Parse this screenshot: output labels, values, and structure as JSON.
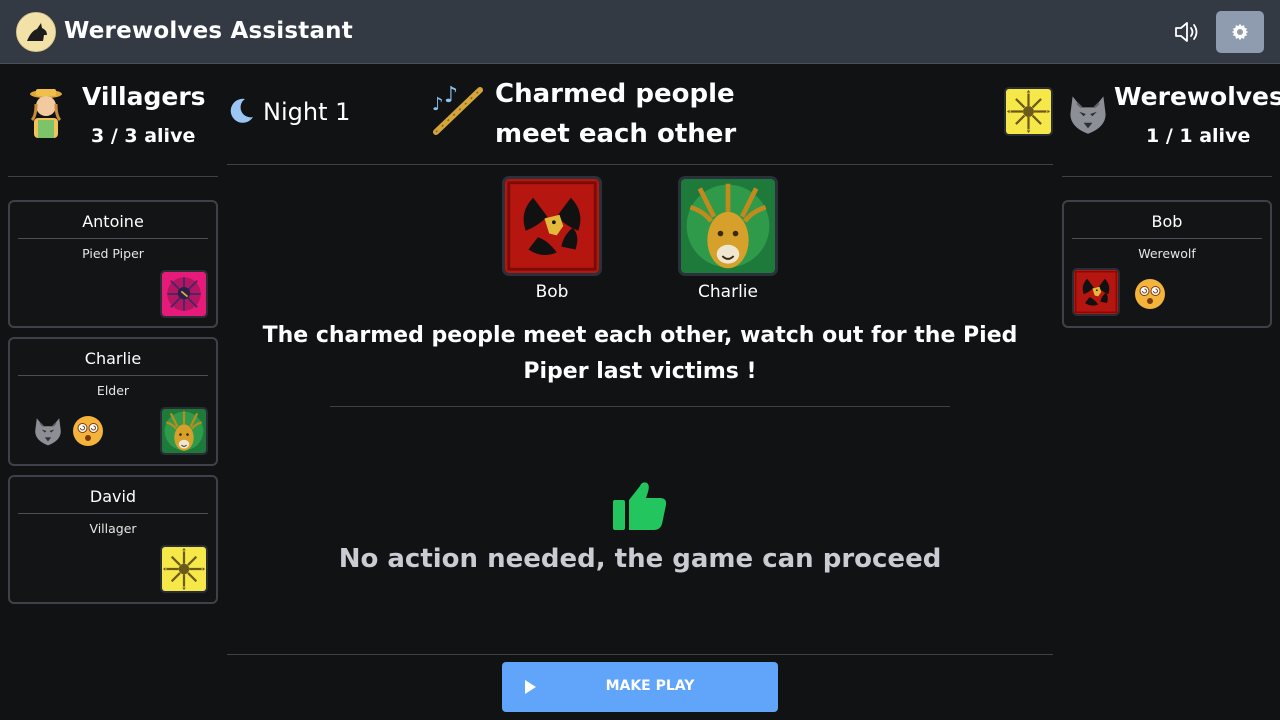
{
  "app": {
    "title": "Werewolves Assistant",
    "logo_icon": "werewolf-moon-logo"
  },
  "toolbar": {
    "sound_icon": "speaker-icon",
    "settings_icon": "gear-icon"
  },
  "villagers": {
    "name": "Villagers",
    "alive": "3 / 3 alive",
    "players": [
      {
        "name": "Antoine",
        "role": "Pied Piper",
        "card": "pied-piper-card"
      },
      {
        "name": "Charlie",
        "role": "Elder",
        "card": "elder-card",
        "attributes": [
          "eaten-wolf-icon",
          "charmed-icon"
        ]
      },
      {
        "name": "David",
        "role": "Villager",
        "card": "villager-card"
      }
    ]
  },
  "werewolves": {
    "name": "Werewolves",
    "alive": "1 / 1 alive",
    "players": [
      {
        "name": "Bob",
        "role": "Werewolf",
        "card": "werewolf-card",
        "attributes": [
          "charmed-icon"
        ]
      }
    ]
  },
  "phase": {
    "name": "Night 1"
  },
  "play": {
    "title": "Charmed people meet each other",
    "targets": [
      {
        "name": "Bob",
        "card": "werewolf-card"
      },
      {
        "name": "Charlie",
        "card": "elder-card"
      }
    ],
    "message": "The charmed people meet each other, watch out for the Pied Piper last victims !",
    "status": "No action needed, the game can proceed",
    "button": "MAKE PLAY"
  },
  "colors": {
    "topbar": "#343a43",
    "accent": "#60a5fa",
    "success": "#22c55e",
    "background": "#111213"
  }
}
